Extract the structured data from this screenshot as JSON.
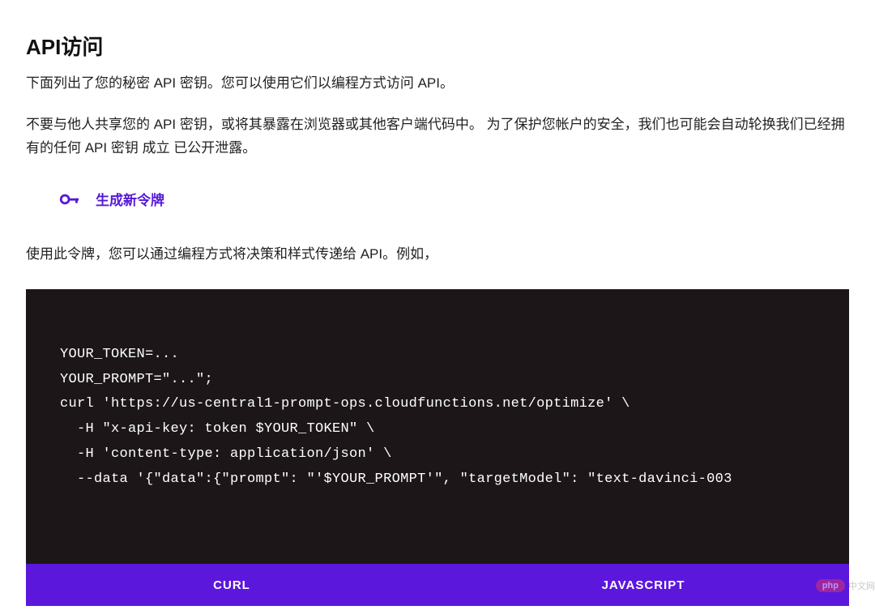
{
  "page": {
    "title": "API访问",
    "description": "下面列出了您的秘密 API 密钥。您可以使用它们以编程方式访问 API。",
    "warning": "不要与他人共享您的 API 密钥，或将其暴露在浏览器或其他客户端代码中。 为了保护您帐户的安全，我们也可能会自动轮换我们已经拥有的任何 API 密钥 成立 已公开泄露。",
    "generateTokenLabel": "生成新令牌",
    "usage": "使用此令牌，您可以通过编程方式将决策和样式传递给 API。例如，"
  },
  "code": {
    "content": "YOUR_TOKEN=...\nYOUR_PROMPT=\"...\";\ncurl 'https://us-central1-prompt-ops.cloudfunctions.net/optimize' \\\n  -H \"x-api-key: token $YOUR_TOKEN\" \\\n  -H 'content-type: application/json' \\\n  --data '{\"data\":{\"prompt\": \"'$YOUR_PROMPT'\", \"targetModel\": \"text-davinci-003"
  },
  "tabs": {
    "curl": "CURL",
    "javascript": "JAVASCRIPT"
  },
  "watermark": {
    "badge": "php",
    "text": "中文网"
  }
}
